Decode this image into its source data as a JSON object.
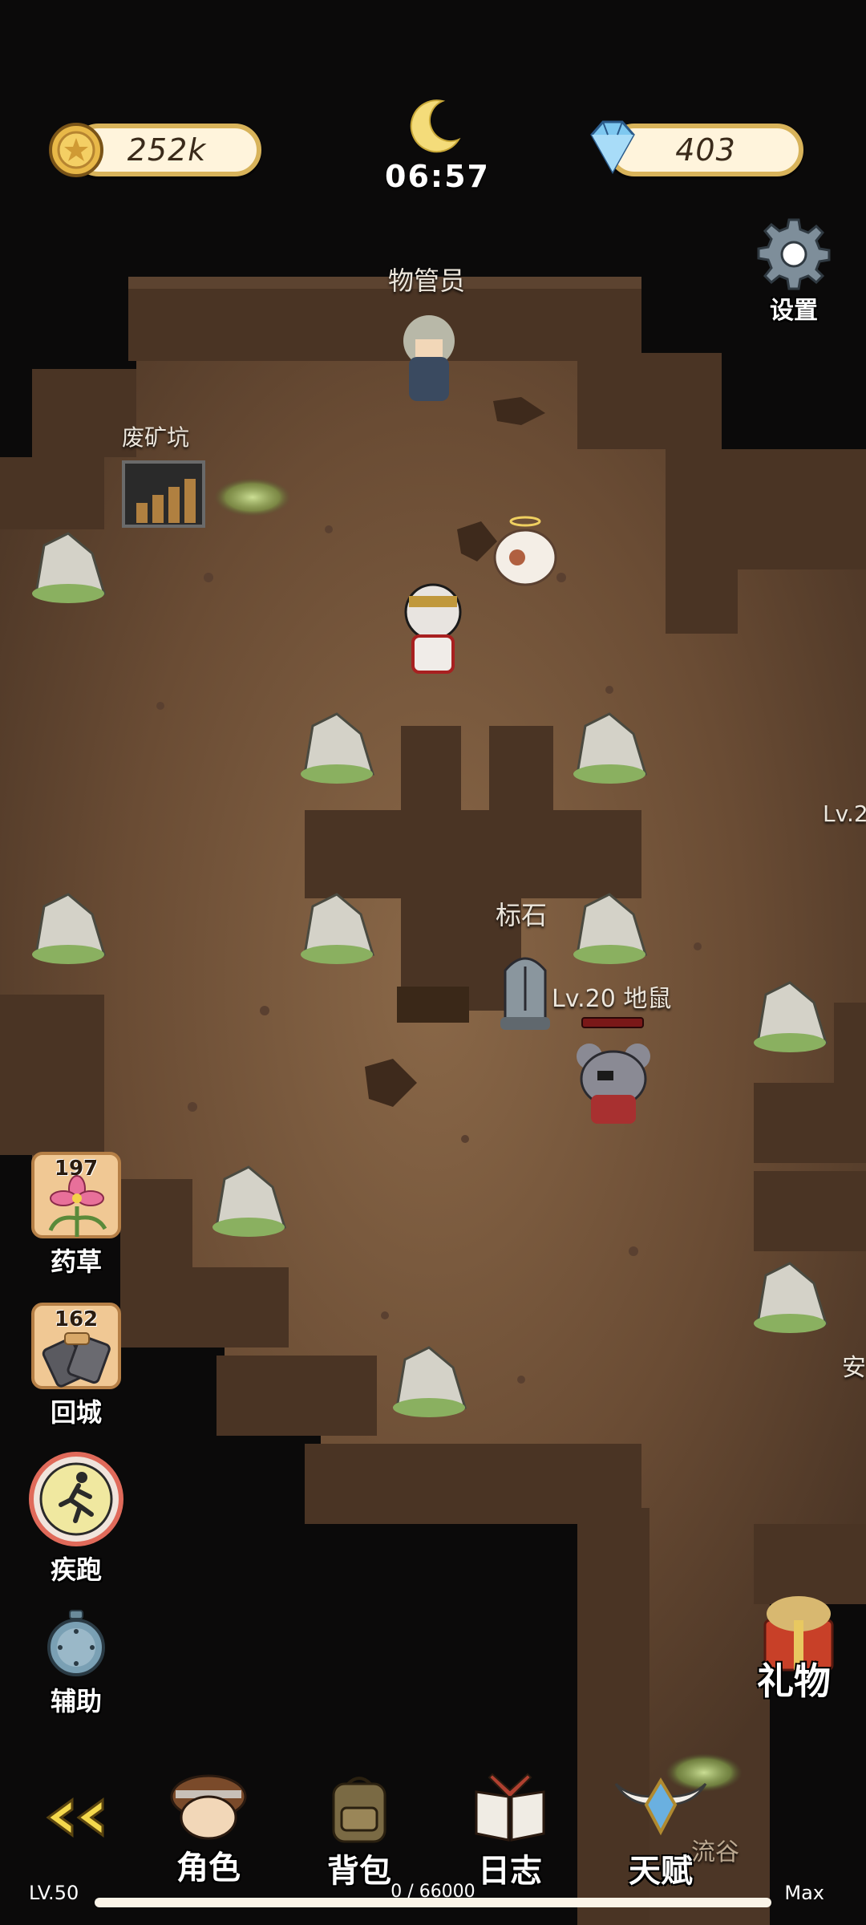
{
  "hud": {
    "gold": "252k",
    "gems": "403",
    "time": "06:57",
    "settings_label": "设置"
  },
  "map": {
    "npc_label": "物管员",
    "mine_label": "废矿坑",
    "stone_label": "标石",
    "enemy_label": "Lv.20 地鼠",
    "edge_enemy_label": "Lv.2",
    "edge_npc_label": "安",
    "area_label": "流谷"
  },
  "side_buttons": {
    "herb": {
      "count": "197",
      "label": "药草"
    },
    "return": {
      "count": "162",
      "label": "回城"
    },
    "sprint_label": "疾跑",
    "assist_label": "辅助"
  },
  "gift_label": "礼物",
  "nav": {
    "back_icon": "double-chevron-left-icon",
    "items": [
      {
        "label": "角色",
        "icon": "character-portrait-icon"
      },
      {
        "label": "背包",
        "icon": "backpack-icon"
      },
      {
        "label": "日志",
        "icon": "book-icon"
      },
      {
        "label": "天赋",
        "icon": "winged-gem-icon"
      }
    ]
  },
  "xp": {
    "level": "LV.50",
    "text": "0 / 66000",
    "max_label": "Max",
    "progress": 0.0
  },
  "colors": {
    "ground": "#6e4f36",
    "cave_wall": "#4a3424",
    "gold_border": "#d8b35a",
    "pill_fill": "#fff4dc"
  }
}
